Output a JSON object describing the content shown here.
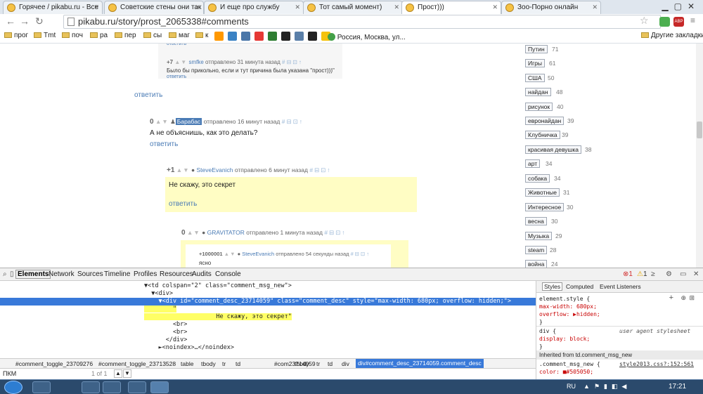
{
  "browser": {
    "tabs": [
      {
        "title": "Горячее / pikabu.ru - Все"
      },
      {
        "title": "Советские стены они так"
      },
      {
        "title": "И еще про службу"
      },
      {
        "title": "Тот самый момент)"
      },
      {
        "title": "Прост)))"
      },
      {
        "title": "Зоо-Порно онлайн"
      }
    ],
    "url": "pikabu.ru/story/prost_2065338#comments",
    "bookmarks": [
      "прог",
      "Tmt",
      "поч",
      "ра",
      "пер",
      "сы",
      "маг",
      "к",
      "Россия, Москва, ул..."
    ],
    "other_bookmarks": "Другие закладки",
    "adblock_label": "ABP"
  },
  "tags": [
    {
      "name": "Путин",
      "count": "71"
    },
    {
      "name": "Игры",
      "count": "61"
    },
    {
      "name": "США",
      "count": "50"
    },
    {
      "name": "найдан",
      "count": "48"
    },
    {
      "name": "рисунок",
      "count": "40"
    },
    {
      "name": "евронайдан",
      "count": "39"
    },
    {
      "name": "Клубничка",
      "count": "39"
    },
    {
      "name": "красивая девушка",
      "count": "38"
    },
    {
      "name": "арт",
      "count": "34"
    },
    {
      "name": "собака",
      "count": "34"
    },
    {
      "name": "Животные",
      "count": "31"
    },
    {
      "name": "Интересное",
      "count": "30"
    },
    {
      "name": "весна",
      "count": "30"
    },
    {
      "name": "Музыка",
      "count": "29"
    },
    {
      "name": "steam",
      "count": "28"
    },
    {
      "name": "война",
      "count": "24"
    }
  ],
  "comments": {
    "c0": {
      "score": "+7",
      "user": "smfke",
      "meta": "отправлено 31 минута назад",
      "text": "Было бы прикольно, если и тут причина была указана \"прост)))\"",
      "reply": "ответить"
    },
    "reply_top": "ответить",
    "c1": {
      "score": "0",
      "user": "Барабас",
      "meta": "отправлено 16 минут назад",
      "text": "А не объяснишь, как это делать?",
      "reply": "ответить"
    },
    "c2": {
      "score": "+1",
      "user": "SteveEvanich",
      "meta": "отправлено 6 минут назад",
      "text": "Не скажу, это секрет",
      "reply": "ответить"
    },
    "c3": {
      "score": "0",
      "user": "GRAVITATOR",
      "meta": "отправлено 1 минута назад"
    },
    "c4": {
      "score": "+1000001",
      "user": "SteveEvanich",
      "meta": "отправлено 54 секунды назад",
      "text": "ясно"
    }
  },
  "devtools": {
    "tabs": [
      "Elements",
      "Network",
      "Sources",
      "Timeline",
      "Profiles",
      "Resources",
      "Audits",
      "Console"
    ],
    "errors": "1",
    "warnings": "1",
    "dom_lines": [
      {
        "text": "▼<td colspan=\"2\" class=\"comment_msg_new\">"
      },
      {
        "text": "  ▼<div>"
      },
      {
        "text": "    ▼<div id=\"comment_desc_23714059\" class=\"comment_desc\" style=\"max-width: 680px; overflow: hidden;\">"
      },
      {
        "text": "        \""
      },
      {
        "text": "                    Не скажу, это секрет\""
      },
      {
        "text": "        <br>"
      },
      {
        "text": "        <br>"
      },
      {
        "text": "      </div>"
      },
      {
        "text": "    ►<noindex>…</noindex>"
      }
    ],
    "breadcrumbs": [
      "#comment_toggle_23709276",
      "#comment_toggle_23713528",
      "table",
      "tbody",
      "tr",
      "td",
      "#com23714059",
      "tbody",
      "tr",
      "td",
      "div",
      "div#comment_desc_23714059.comment_desc"
    ],
    "search_value": "ПКМ",
    "search_count": "1 of 1",
    "side_tabs": [
      "Styles",
      "Computed",
      "Event Listeners"
    ],
    "styles": [
      "element.style {",
      "  max-width: 680px;",
      "  overflow: ▶hidden;",
      "}",
      "div {",
      "  display: block;",
      "}",
      "Inherited from td.comment_msg_new",
      ".comment_msg_new {",
      "  color: ■#505050;"
    ],
    "user_agent": "user agent stylesheet",
    "source_link": "style2013.css?:152:561"
  },
  "taskbar": {
    "lang": "RU",
    "clock": "17:21"
  }
}
